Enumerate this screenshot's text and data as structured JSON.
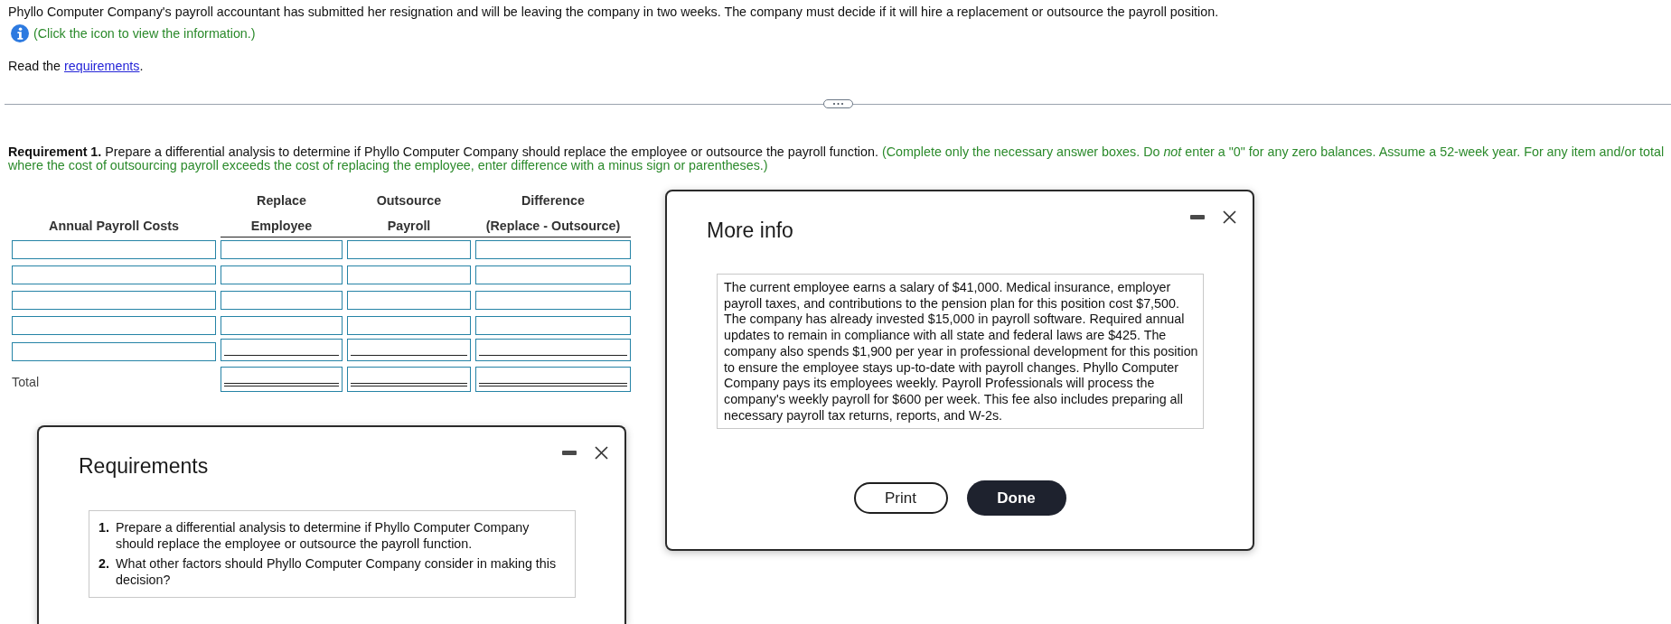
{
  "intro": "Phyllo Computer Company's payroll accountant has submitted her resignation and will be leaving the company in two weeks. The company must decide if it will hire a replacement or outsource the payroll position.",
  "info_prompt": "(Click the icon to view the information.)",
  "read_line": {
    "text": "Read the",
    "link": "requirements",
    "end": "."
  },
  "requirement": {
    "label": "Requirement 1.",
    "text": "Prepare a differential analysis to determine if Phyllo Computer Company should replace the employee or outsource the payroll function.",
    "instruction": "(Complete only the necessary answer boxes. Do *not* enter a \"0\" for any zero balances. Assume a 52-week year. For any item and/or total where the cost of outsourcing payroll exceeds the cost of replacing the employee, enter difference with a minus sign or parentheses.)"
  },
  "table": {
    "columns": [
      {
        "heading": [
          "Annual Payroll Costs"
        ]
      },
      {
        "heading": [
          "Replace",
          "Employee"
        ]
      },
      {
        "heading": [
          "Outsource",
          "Payroll"
        ]
      },
      {
        "heading": [
          "Difference",
          "(Replace - Outsource)"
        ]
      }
    ],
    "rows": [
      {
        "kind": "entry"
      },
      {
        "kind": "entry"
      },
      {
        "kind": "entry"
      },
      {
        "kind": "entry"
      },
      {
        "kind": "subtotal"
      },
      {
        "kind": "total",
        "label": "Total"
      }
    ]
  },
  "dialogs": [
    {
      "kind": "requirements",
      "title": "Requirements",
      "items": [
        {
          "number": "1.",
          "text": "Prepare a differential analysis to determine if Phyllo Computer Company should replace the employee or outsource the payroll function."
        },
        {
          "number": "2.",
          "text": "What other factors should Phyllo Computer Company consider in making this decision?"
        }
      ]
    },
    {
      "kind": "info",
      "title": "More info",
      "body": "The current employee earns a salary of $41,000. Medical insurance, employer payroll taxes, and contributions to the pension plan for this position cost $7,500. The company has already invested $15,000 in payroll software. Required annual updates to remain in compliance with all state and federal laws are $425. The company also spends $1,900 per year in professional development for this position to ensure the employee stays up-to-date with payroll changes. Phyllo Computer Company pays its employees weekly. Payroll Professionals will process the company's weekly payroll for $600 per week. This fee also includes preparing all necessary payroll tax returns, reports, and W-2s.",
      "buttons": [
        {
          "label": "Print",
          "kind": "secondary"
        },
        {
          "label": "Done",
          "kind": "primary"
        }
      ]
    }
  ]
}
